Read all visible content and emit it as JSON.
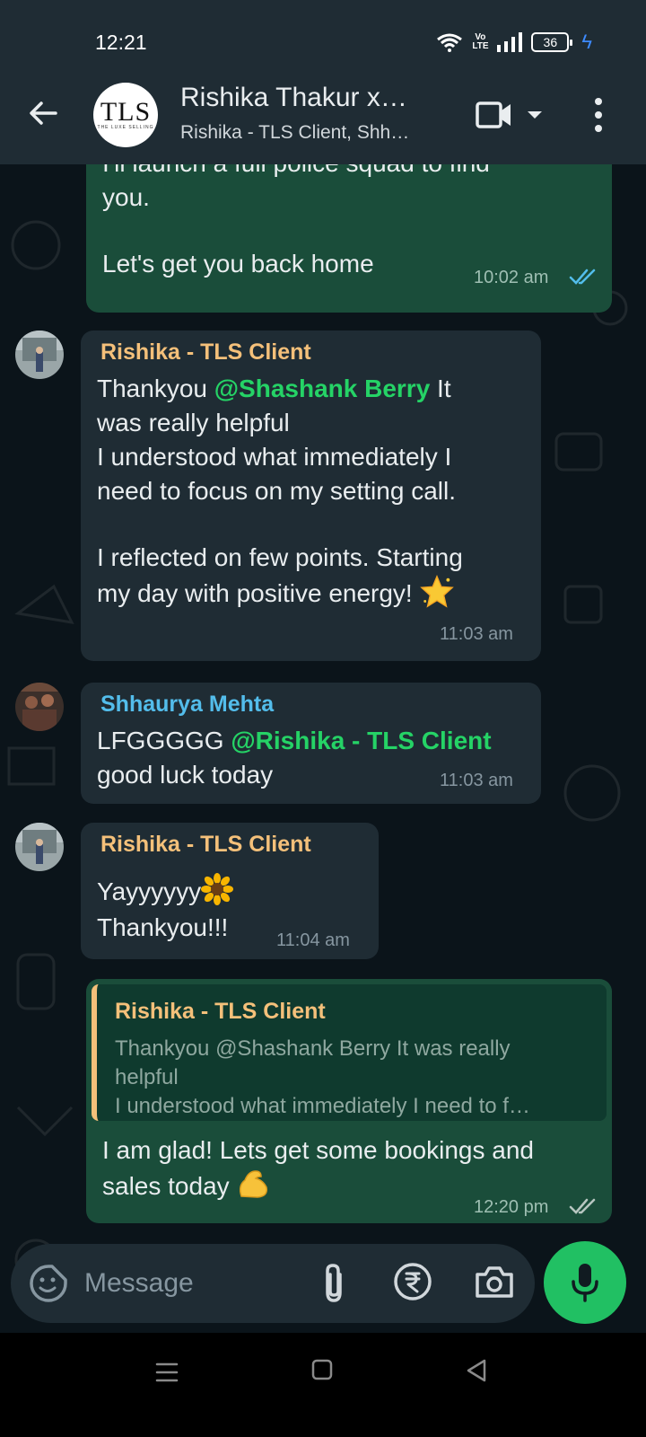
{
  "status_bar": {
    "time": "12:21",
    "volte": "Vo\nLTE",
    "battery": "36"
  },
  "header": {
    "title": "Rishika Thakur x…",
    "subtitle": "Rishika - TLS Client, Shh…",
    "avatar_logo": "TLS",
    "avatar_logo_sub": "THE LUXE SELLING"
  },
  "messages": [
    {
      "direction": "out",
      "text_top": "I'll launch a full police squad to find\nyou.",
      "text_bottom": "Let's get you back home",
      "time": "10:02 am",
      "ticks": "read"
    },
    {
      "direction": "in",
      "sender": "Rishika - TLS Client",
      "line1_before": "Thankyou ",
      "mention": "@Shashank Berry",
      "line1_after": " It",
      "rest": "was really helpful\n I understood what immediately I\nneed to focus on my setting call.",
      "para2": "I reflected on few points. Starting\nmy day with positive energy! ",
      "emoji": "star",
      "time": "11:03 am"
    },
    {
      "direction": "in",
      "sender": "Shhaurya Mehta",
      "before": "LFGGGGG ",
      "mention": "@Rishika - TLS Client",
      "after": "good luck today",
      "time": "11:03 am"
    },
    {
      "direction": "in",
      "sender": "Rishika - TLS Client",
      "line1": "Yayyyyyy",
      "emoji": "sunflower",
      "line2": "Thankyou!!!",
      "time": "11:04 am"
    },
    {
      "direction": "out",
      "quote_sender": "Rishika - TLS Client",
      "quote_text": "Thankyou @Shashank Berry It was really\nhelpful\n I understood what immediately I need to f…",
      "text": "I am glad! Lets get some bookings and\nsales today ",
      "emoji": "flexed-biceps",
      "time": "12:20 pm",
      "ticks": "delivered"
    }
  ],
  "composer": {
    "placeholder": "Message"
  },
  "colors": {
    "header_bg": "#1f2c34",
    "outgoing_bubble": "#1a4d3a",
    "incoming_bubble": "#1f2c34",
    "mention": "#25d366",
    "sender_rishika": "#f4c07a",
    "sender_shhaurya": "#53bdeb",
    "read_ticks": "#53bdeb",
    "mic_button": "#21c063"
  }
}
